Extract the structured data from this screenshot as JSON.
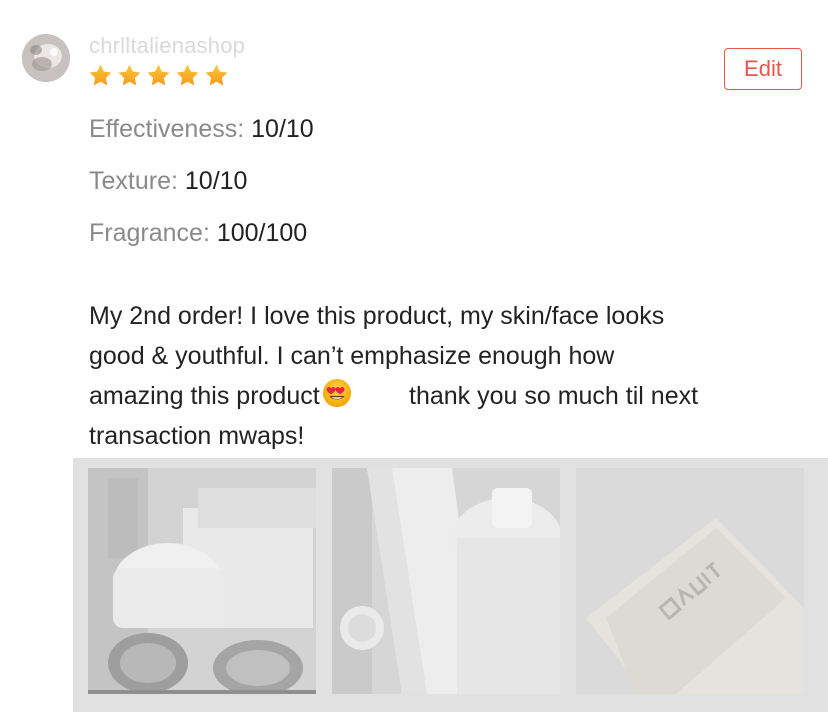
{
  "review": {
    "username": "chrlltalienashop",
    "rating": 5,
    "rating_max": 5,
    "edit_label": "Edit",
    "attributes": [
      {
        "label": "Effectiveness:",
        "value": "10/10"
      },
      {
        "label": "Texture:",
        "value": "10/10"
      },
      {
        "label": "Fragrance:",
        "value": "100/100"
      }
    ],
    "text_lines": [
      "My 2nd order! I love this product, my skin/face looks",
      "good & youthful. I can’t emphasize enough how",
      "amazing this product",
      "thank you so much til next",
      "transaction mwaps!"
    ],
    "emoji": "heart-eyes-emoji",
    "photos": [
      {
        "name": "review-photo-1"
      },
      {
        "name": "review-photo-2"
      },
      {
        "name": "review-photo-3"
      }
    ]
  },
  "colors": {
    "accent": "#e5574a",
    "star": "#f5a623",
    "label_gray": "#8a8a8a",
    "text": "#222222",
    "username": "#d9d9d9"
  },
  "icons": {
    "avatar": "user-avatar",
    "star": "star-icon"
  }
}
